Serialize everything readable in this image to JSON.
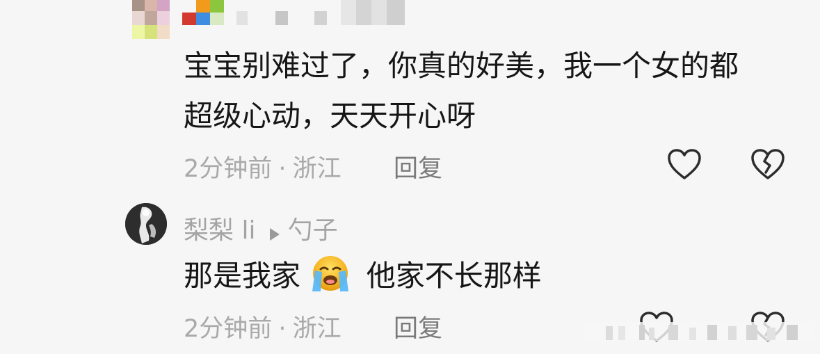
{
  "comment1": {
    "text_line1": "宝宝别难过了，你真的好美，我一个女的都",
    "text_line2": "超级心动，天天开心呀",
    "time": "2分钟前",
    "separator": "·",
    "location": "浙江",
    "reply_label": "回复"
  },
  "comment2": {
    "username": "梨梨 li",
    "reply_to": "勺子",
    "text_before_emoji": "那是我家",
    "text_after_emoji": "他家不长那样",
    "time": "2分钟前",
    "separator": "·",
    "location": "浙江",
    "reply_label": "回复"
  },
  "icons": {
    "like": "heart-outline-icon",
    "dislike": "broken-heart-icon",
    "reply_arrow": "play-triangle-icon",
    "emoji": "crying-face-emoji"
  },
  "colors": {
    "background": "#f6f6f6",
    "text": "#161616",
    "meta": "#a9a9a9",
    "reply": "#7a7a7a"
  }
}
